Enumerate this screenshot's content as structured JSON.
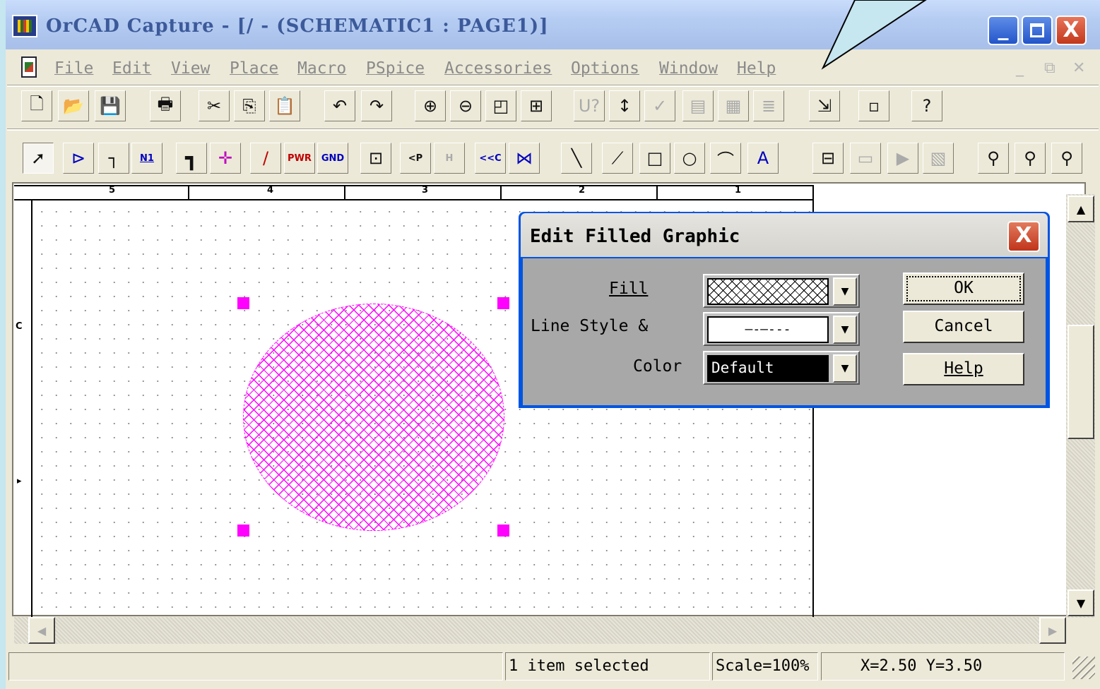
{
  "window": {
    "title": "OrCAD Capture - [/ - (SCHEMATIC1 : PAGE1)]",
    "controls": {
      "minimize": "_",
      "close": "X"
    }
  },
  "menu": {
    "items": [
      {
        "label": "File"
      },
      {
        "label": "Edit"
      },
      {
        "label": "View"
      },
      {
        "label": "Place"
      },
      {
        "label": "Macro"
      },
      {
        "label": "PSpice"
      },
      {
        "label": "Accessories"
      },
      {
        "label": "Options"
      },
      {
        "label": "Window"
      },
      {
        "label": "Help"
      }
    ],
    "mdi": {
      "minimize": "_",
      "restore": "⧉",
      "close": "✕"
    }
  },
  "toolbar1": {
    "icons": [
      "new-document-icon",
      "open-folder-icon",
      "save-disk-icon",
      "print-icon",
      "cut-scissors-icon",
      "copy-icon",
      "paste-icon",
      "undo-icon",
      "redo-icon",
      "zoom-in-icon",
      "zoom-out-icon",
      "zoom-area-icon",
      "zoom-all-icon",
      "annotate-icon",
      "back-annotate-icon",
      "drc-icon",
      "netlist-icon",
      "cross-reference-icon",
      "bill-of-materials-icon",
      "snap-to-grid-icon",
      "project-manager-icon",
      "help-icon"
    ],
    "glyphs": [
      "🗋",
      "📂",
      "💾",
      "🖶",
      "✂",
      "⎘",
      "📋",
      "↶",
      "↷",
      "⊕",
      "⊖",
      "◰",
      "⊞",
      "U?",
      "↕",
      "✓",
      "▤",
      "▦",
      "≣",
      "⇲",
      "▫",
      "?"
    ]
  },
  "toolbar2": {
    "labels": {
      "pwr": "PWR",
      "gnd": "GND",
      "n1": "N1",
      "ofp": "<P",
      "offh": "H",
      "offc": "<<C",
      "text": "A"
    }
  },
  "schematic": {
    "zones": [
      "5",
      "4",
      "3",
      "2",
      "1"
    ],
    "edge_marks": [
      "C",
      "▸"
    ],
    "fill_color": "#ff00ff"
  },
  "dialog": {
    "title": "Edit Filled Graphic",
    "close": "X",
    "fill_label": "Fill",
    "line_style_label": "Line Style &",
    "color_label": "Color",
    "line_style_value": "—-—---",
    "color_value": "Default",
    "ok": "OK",
    "cancel": "Cancel",
    "help": "Help"
  },
  "status": {
    "selection": "1 item selected",
    "scale": "Scale=100%",
    "coords": "X=2.50  Y=3.50"
  },
  "colors": {
    "selection_handles": "#ff00ff",
    "slide_background": "#c6e6f0"
  }
}
